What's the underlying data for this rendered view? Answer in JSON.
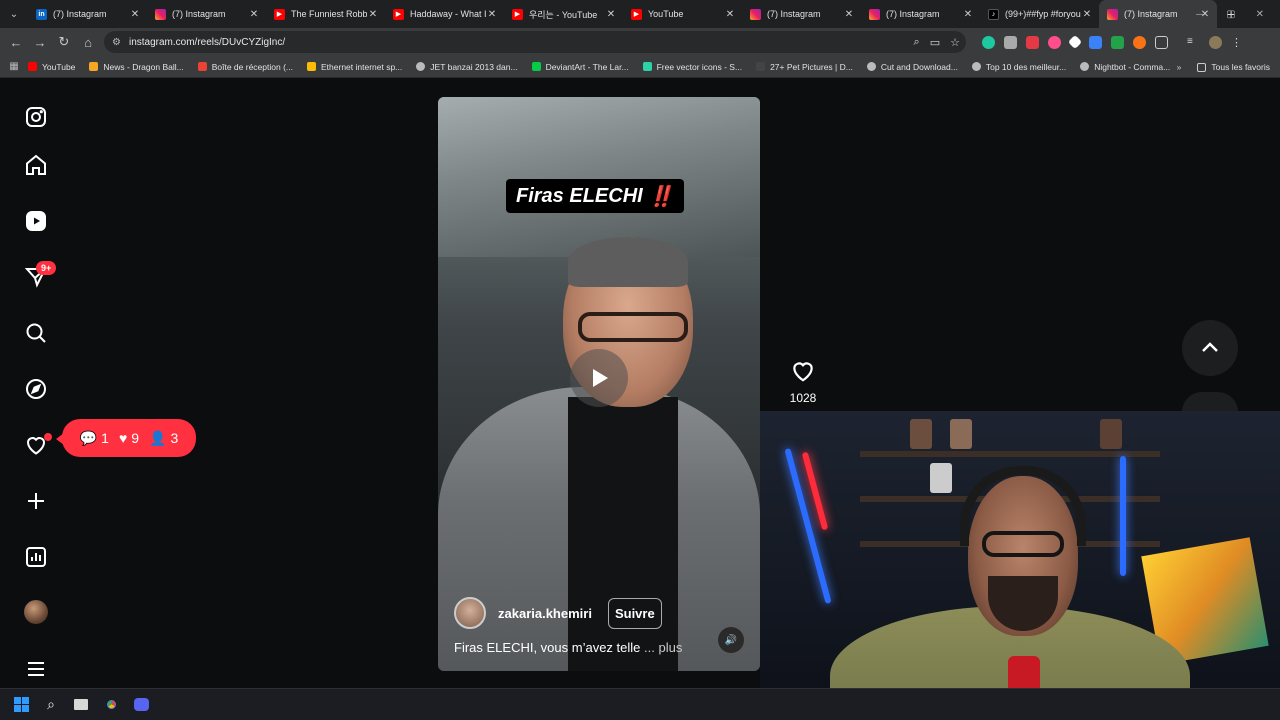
{
  "browser": {
    "tabs": [
      {
        "title": "(7) Instagram",
        "favicon": "linkedin-icon",
        "active": false
      },
      {
        "title": "(7) Instagram",
        "favicon": "instagram-icon",
        "active": false
      },
      {
        "title": "The Funniest Robbe",
        "favicon": "youtube-icon",
        "active": false
      },
      {
        "title": "Haddaway - What I",
        "favicon": "youtube-icon",
        "active": false
      },
      {
        "title": "우리는 - YouTube",
        "favicon": "youtube-icon",
        "active": false
      },
      {
        "title": "YouTube",
        "favicon": "youtube-icon",
        "active": false
      },
      {
        "title": "(7) Instagram",
        "favicon": "instagram-icon",
        "active": false
      },
      {
        "title": "(7) Instagram",
        "favicon": "instagram-icon",
        "active": false
      },
      {
        "title": "(99+)##fyp #foryou",
        "favicon": "tiktok-icon",
        "active": false
      },
      {
        "title": "(7) Instagram",
        "favicon": "instagram-icon",
        "active": true
      }
    ],
    "url": "instagram.com/reels/DUvCYZigInc/",
    "bookmarks": [
      {
        "label": "YouTube",
        "color": "#ff0000"
      },
      {
        "label": "News - Dragon Ball...",
        "color": "#f5a623"
      },
      {
        "label": "Boîte de réception (...",
        "color": "#ea4335"
      },
      {
        "label": "Ethernet internet sp...",
        "color": "#fbbc05"
      },
      {
        "label": "JET banzai 2013 dan...",
        "color": "#bbbbbb"
      },
      {
        "label": "DeviantArt - The Lar...",
        "color": "#05cc47"
      },
      {
        "label": "Free vector icons - S...",
        "color": "#2ad4a6"
      },
      {
        "label": "27+ Pet Pictures | D...",
        "color": "#444444"
      },
      {
        "label": "Cut and Download...",
        "color": "#bbbbbb"
      },
      {
        "label": "Top 10 des meilleur...",
        "color": "#bbbbbb"
      },
      {
        "label": "Nightbot - Comma...",
        "color": "#bbbbbb"
      }
    ],
    "all_bookmarks_label": "Tous les favoris"
  },
  "instagram": {
    "sidebar_badge": "9+",
    "notifications": {
      "comments": "1",
      "likes": "9",
      "followers": "3"
    },
    "reel": {
      "title_text": "Firas ELECHI",
      "title_emoji": "‼️",
      "username": "zakaria.khemiri",
      "follow_label": "Suivre",
      "caption": "Firas ELECHI, vous m’avez telle",
      "caption_more": "... plus"
    },
    "likes_count": "1028"
  },
  "colors": {
    "accent_red": "#ff3040",
    "tab_active": "#3a3b3d"
  }
}
